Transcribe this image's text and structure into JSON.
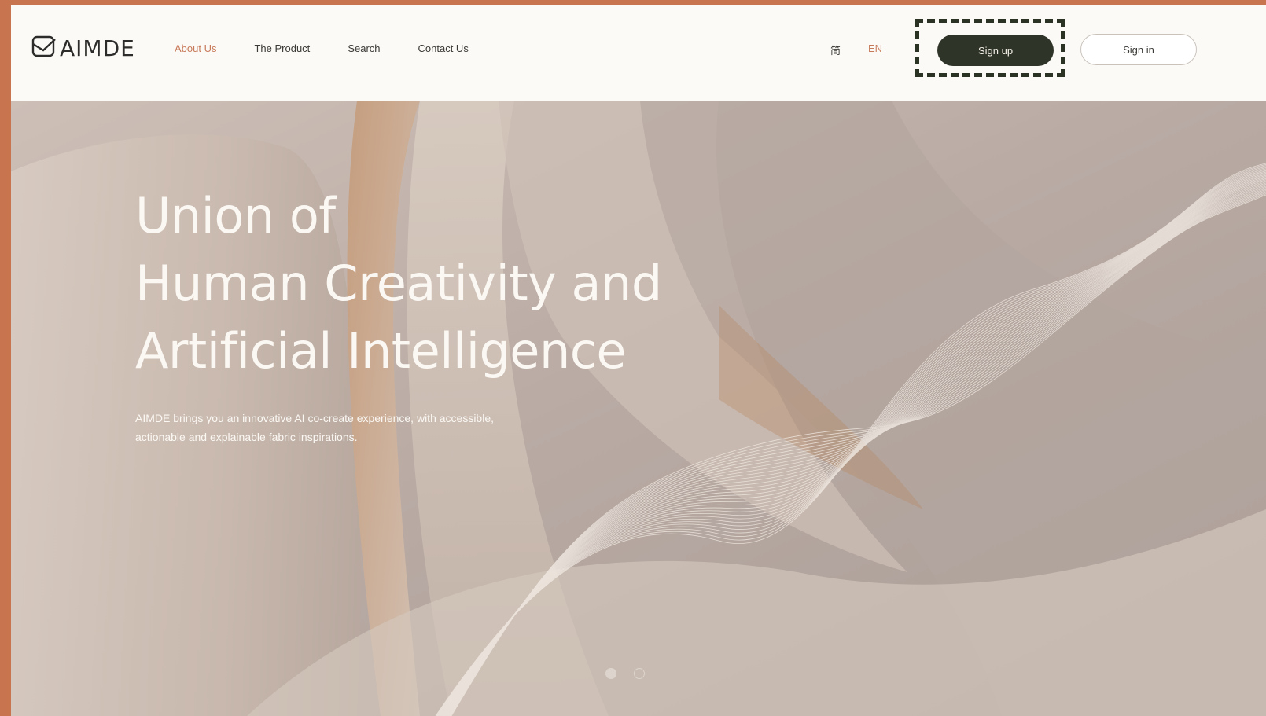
{
  "brand": {
    "logo_text": "AIMDE"
  },
  "nav": {
    "items": [
      {
        "label": "About Us",
        "active": true
      },
      {
        "label": "The Product",
        "active": false
      },
      {
        "label": "Search",
        "active": false
      },
      {
        "label": "Contact Us",
        "active": false
      }
    ]
  },
  "lang": {
    "zh": "简",
    "en": "EN"
  },
  "auth": {
    "signup_label": "Sign up",
    "signin_label": "Sign in"
  },
  "hero": {
    "title_lines": [
      "Union of",
      "Human Creativity and",
      "Artificial Intelligence"
    ],
    "description": "AIMDE brings you an innovative AI co-create experience, with accessible, actionable and explainable fabric inspirations."
  },
  "carousel": {
    "slides": 2,
    "active_index": 0
  },
  "colors": {
    "accent": "#c77a5a",
    "dark_button": "#2e3428",
    "frame": "#c8744e"
  }
}
